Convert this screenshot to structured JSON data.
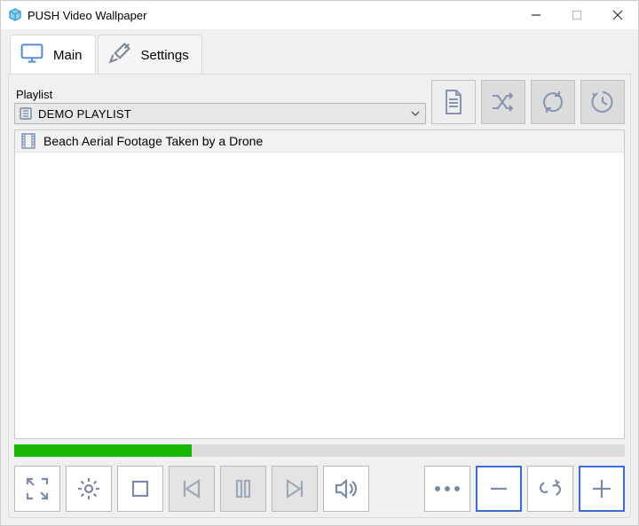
{
  "window": {
    "title": "PUSH Video Wallpaper"
  },
  "tabs": {
    "main": "Main",
    "settings": "Settings",
    "active": "main"
  },
  "playlist": {
    "label": "Playlist",
    "selected": "DEMO PLAYLIST"
  },
  "items": [
    {
      "title": "Beach Aerial Footage Taken by a Drone"
    }
  ],
  "progress": {
    "percent": 29
  },
  "icons": {
    "app": "push-cube-icon",
    "monitor": "monitor-icon",
    "wrench": "wrench-icon",
    "document": "document-icon",
    "shuffle": "shuffle-icon",
    "refresh": "refresh-icon",
    "timer": "timer-icon",
    "film": "film-icon",
    "fullscreen": "fullscreen-icon",
    "gear": "gear-icon",
    "stop": "stop-icon",
    "prev": "previous-icon",
    "pause": "pause-icon",
    "next": "next-icon",
    "volume": "volume-icon",
    "more": "more-icon",
    "remove": "minus-icon",
    "unlink": "link-break-icon",
    "add": "plus-icon"
  }
}
